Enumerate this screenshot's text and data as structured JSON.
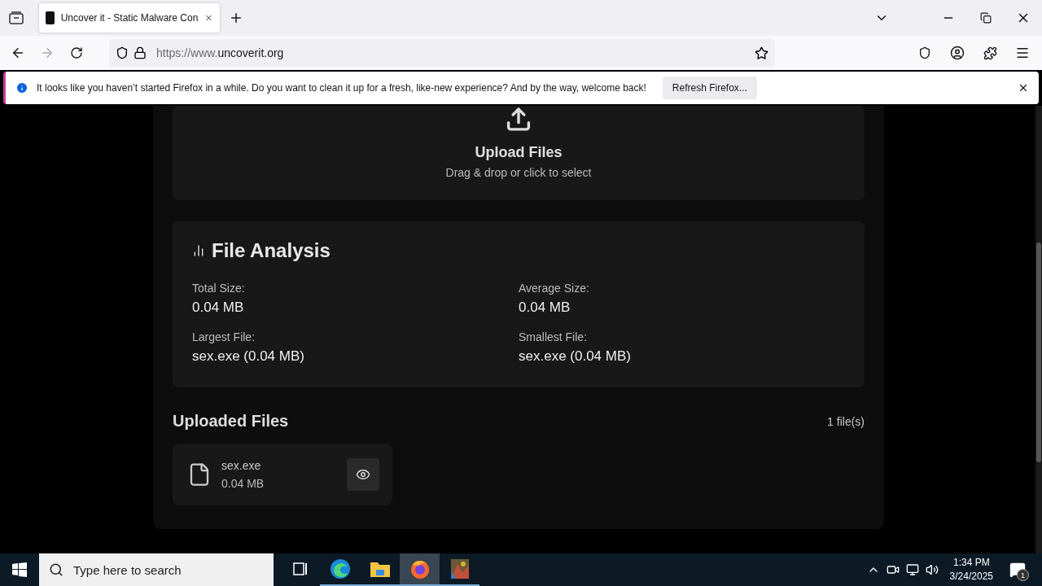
{
  "browser": {
    "tab": {
      "title": "Uncover it - Static Malware Con",
      "selected": true
    },
    "url": {
      "prefix": "https://www.",
      "domain": "uncoverit.org"
    },
    "notification": {
      "text": "It looks like you haven’t started Firefox in a while. Do you want to clean it up for a fresh, like-new experience? And by the way, welcome back!",
      "button": "Refresh Firefox..."
    }
  },
  "upload": {
    "title": "Upload Files",
    "subtitle": "Drag & drop or click to select"
  },
  "analysis": {
    "title": "File Analysis",
    "stats": [
      {
        "label": "Total Size:",
        "value": "0.04 MB"
      },
      {
        "label": "Average Size:",
        "value": "0.04 MB"
      },
      {
        "label": "Largest File:",
        "value": "sex.exe (0.04 MB)"
      },
      {
        "label": "Smallest File:",
        "value": "sex.exe (0.04 MB)"
      }
    ]
  },
  "uploaded": {
    "title": "Uploaded Files",
    "count": "1 file(s)",
    "files": [
      {
        "name": "sex.exe",
        "size": "0.04 MB"
      }
    ]
  },
  "taskbar": {
    "search_placeholder": "Type here to search",
    "apps": [
      {
        "kind": "taskview",
        "running": false,
        "selected": false
      },
      {
        "kind": "edge",
        "running": true,
        "selected": false
      },
      {
        "kind": "explorer",
        "running": true,
        "selected": false
      },
      {
        "kind": "firefox",
        "running": true,
        "selected": true
      },
      {
        "kind": "picture",
        "running": true,
        "selected": false
      }
    ],
    "time": "1:34 PM",
    "date": "3/24/2025",
    "notifications": "1"
  }
}
